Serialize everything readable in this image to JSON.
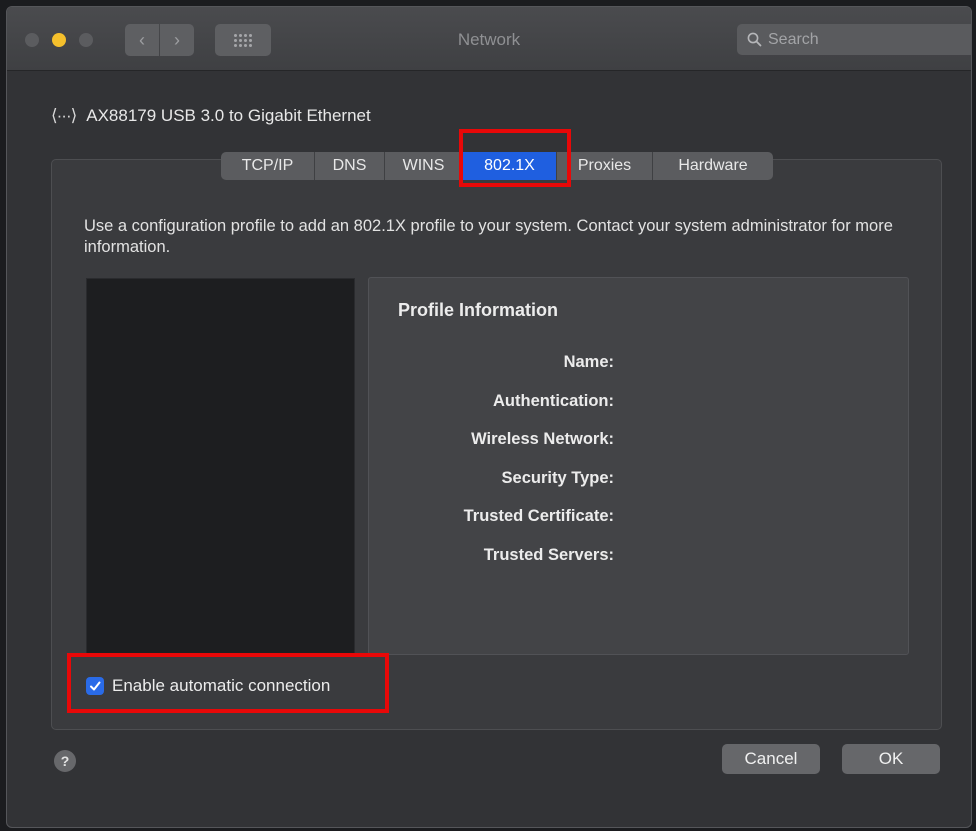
{
  "window": {
    "title": "Network"
  },
  "search": {
    "placeholder": "Search"
  },
  "device": {
    "name": "AX88179 USB 3.0 to Gigabit Ethernet",
    "icon": "ethernet-arrows-icon"
  },
  "tabs": [
    {
      "label": "TCP/IP",
      "active": false
    },
    {
      "label": "DNS",
      "active": false
    },
    {
      "label": "WINS",
      "active": false
    },
    {
      "label": "802.1X",
      "active": true
    },
    {
      "label": "Proxies",
      "active": false
    },
    {
      "label": "Hardware",
      "active": false
    }
  ],
  "description": "Use a configuration profile to add an 802.1X profile to your system. Contact your system administrator for more information.",
  "profile_info": {
    "heading": "Profile Information",
    "labels": [
      "Name:",
      "Authentication:",
      "Wireless Network:",
      "Security Type:",
      "Trusted Certificate:",
      "Trusted Servers:"
    ]
  },
  "checkbox": {
    "label": "Enable automatic connection",
    "checked": true
  },
  "buttons": {
    "help": "?",
    "cancel": "Cancel",
    "ok": "OK"
  },
  "colors": {
    "accent": "#1f5fe0",
    "highlight": "#e80808",
    "traffic_minimize": "#f5c02c"
  }
}
